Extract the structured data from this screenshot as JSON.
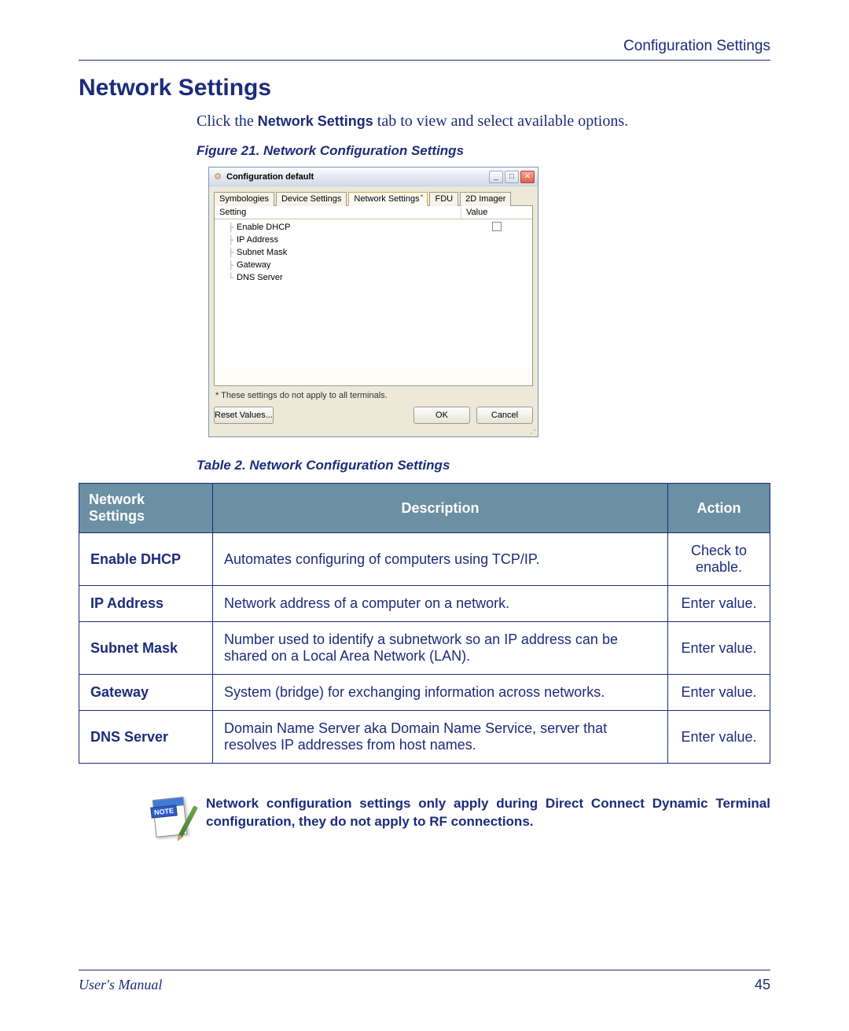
{
  "header": {
    "breadcrumb": "Configuration Settings"
  },
  "section_title": "Network Settings",
  "intro": {
    "prefix": "Click the ",
    "bold": "Network Settings",
    "suffix": " tab to view and select available options."
  },
  "figure_caption": "Figure 21. Network Configuration Settings",
  "dialog": {
    "title": "Configuration default",
    "tabs": [
      "Symbologies",
      "Device Settings",
      "Network Settings",
      "FDU",
      "2D Imager"
    ],
    "active_tab_index": 2,
    "columns": {
      "setting": "Setting",
      "value": "Value"
    },
    "rows": [
      {
        "label": "Enable DHCP",
        "value_type": "checkbox"
      },
      {
        "label": "IP Address",
        "value_type": "blank"
      },
      {
        "label": "Subnet Mask",
        "value_type": "blank"
      },
      {
        "label": "Gateway",
        "value_type": "blank"
      },
      {
        "label": "DNS Server",
        "value_type": "blank"
      }
    ],
    "footnote": "* These settings do not apply to all terminals.",
    "buttons": {
      "reset": "Reset Values...",
      "ok": "OK",
      "cancel": "Cancel"
    }
  },
  "table_caption": "Table 2. Network Configuration Settings",
  "table": {
    "headers": {
      "c1": "Network Settings",
      "c2": "Description",
      "c3": "Action"
    },
    "rows": [
      {
        "name": "Enable DHCP",
        "desc": "Automates configuring of computers using TCP/IP.",
        "action": "Check to enable."
      },
      {
        "name": "IP Address",
        "desc": "Network address of a computer on a network.",
        "action": "Enter value."
      },
      {
        "name": "Subnet Mask",
        "desc": "Number used to identify a subnetwork so an IP address can be shared on a Local Area Network (LAN).",
        "action": "Enter value."
      },
      {
        "name": "Gateway",
        "desc": "System (bridge) for exchanging information across networks.",
        "action": "Enter value."
      },
      {
        "name": "DNS Server",
        "desc": "Domain Name Server aka Domain Name Service, server that resolves IP addresses from host names.",
        "action": "Enter value."
      }
    ]
  },
  "note": {
    "badge": "NOTE",
    "text": "Network configuration settings only apply during Direct Connect Dynamic Terminal configuration, they do not apply to RF connections."
  },
  "footer": {
    "manual": "User's Manual",
    "page": "45"
  }
}
